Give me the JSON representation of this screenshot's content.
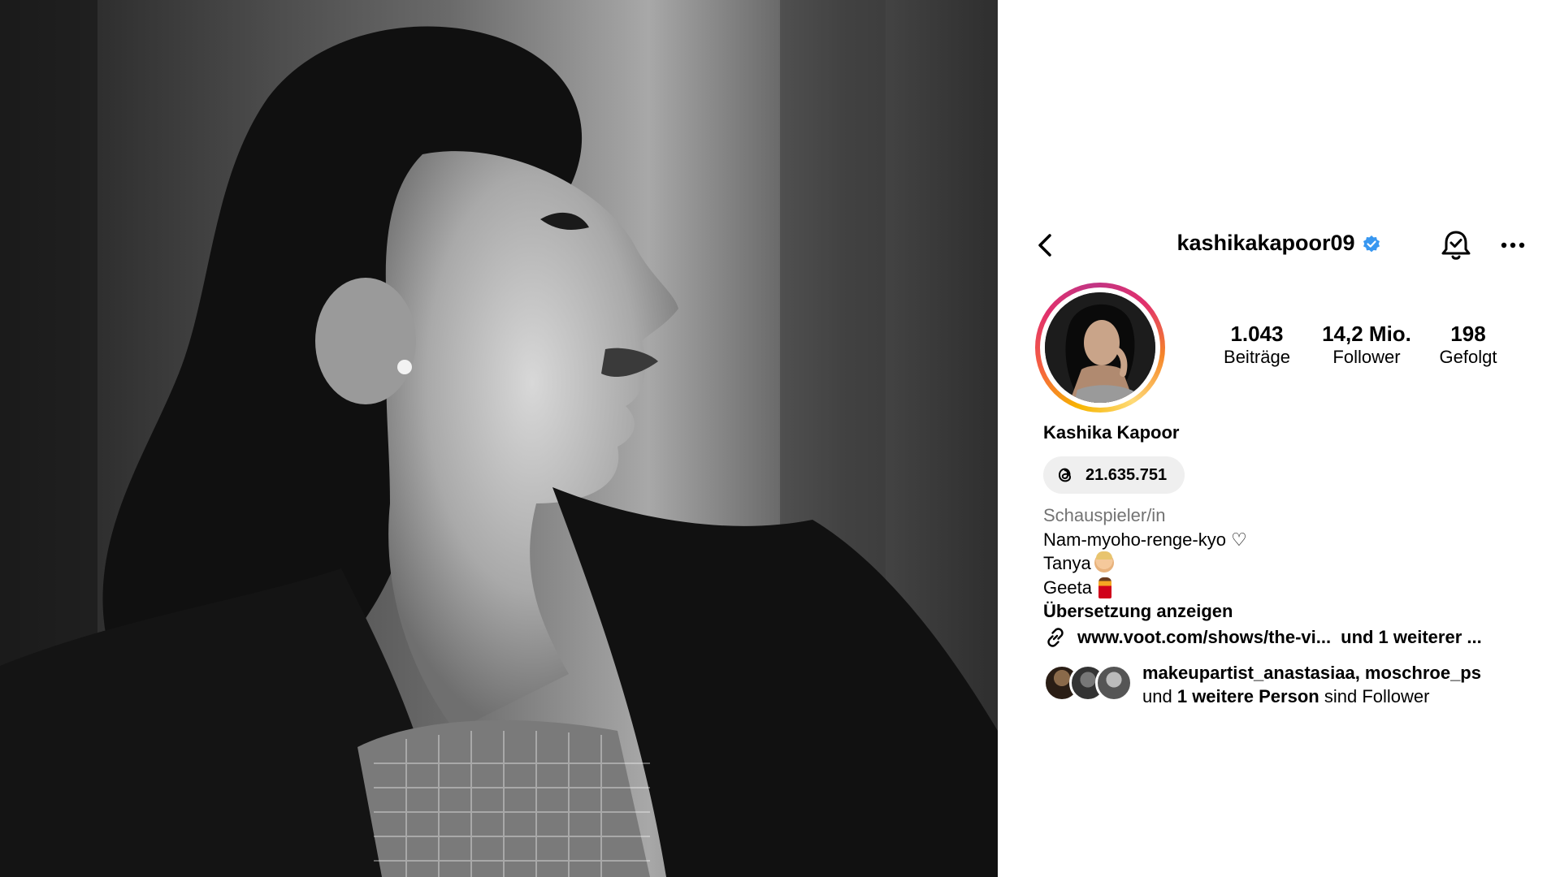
{
  "header": {
    "username": "kashikakapoor09",
    "verified": true
  },
  "stats": {
    "posts": {
      "value": "1.043",
      "label": "Beiträge"
    },
    "followers": {
      "value": "14,2 Mio.",
      "label": "Follower"
    },
    "following": {
      "value": "198",
      "label": "Gefolgt"
    }
  },
  "profile": {
    "display_name": "Kashika Kapoor",
    "threads_count": "21.635.751",
    "category": "Schauspieler/in",
    "bio_lines": [
      "Nam-myoho-renge-kyo ♡",
      "Tanya",
      "Geeta"
    ],
    "translate_label": "Übersetzung anzeigen",
    "link_text": "www.voot.com/shows/the-vi...",
    "link_more": "und 1 weiterer ..."
  },
  "followed_by": {
    "names": "makeupartist_anastasiaa, moschroe_ps",
    "prefix": "und",
    "more": "1 weitere Person",
    "suffix": "sind Follower"
  },
  "colors": {
    "verified_blue": "#3897f0",
    "category_gray": "#737373",
    "pill_bg": "#efefef"
  },
  "icons": [
    "chevron-left-icon",
    "verified-badge-icon",
    "bell-check-icon",
    "more-horizontal-icon",
    "threads-icon",
    "link-icon"
  ]
}
